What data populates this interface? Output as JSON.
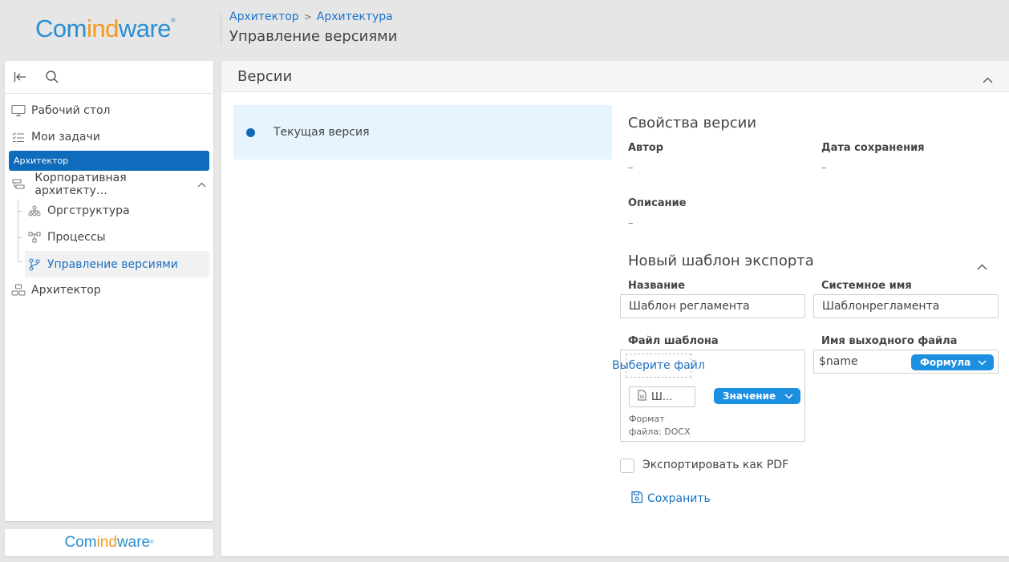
{
  "logo": {
    "part1": "Com",
    "part2": "ind",
    "part3": "ware",
    "mark": "®"
  },
  "breadcrumb": {
    "items": [
      "Архитектор",
      "Архитектура"
    ],
    "separator": ">"
  },
  "page_title": "Управление версиями",
  "sidebar": {
    "group_label": "Архитектор",
    "items": [
      {
        "label": "Рабочий стол",
        "icon": "desktop-icon"
      },
      {
        "label": "Мои задачи",
        "icon": "tasks-icon"
      },
      {
        "label": "Корпоративная архитекту…",
        "icon": "architecture-icon"
      },
      {
        "label": "Оргструктура",
        "icon": "org-structure-icon"
      },
      {
        "label": "Процессы",
        "icon": "process-icon"
      },
      {
        "label": "Управление версиями",
        "icon": "version-branch-icon"
      },
      {
        "label": "Архитектор",
        "icon": "architect-icon"
      }
    ]
  },
  "footer_logo": {
    "part1": "Com",
    "part2": "ind",
    "part3": "ware",
    "mark": "®"
  },
  "versions": {
    "title": "Версии",
    "list": [
      {
        "label": "Текущая версия"
      }
    ]
  },
  "properties": {
    "title": "Свойства версии",
    "author_label": "Автор",
    "author_value": "–",
    "saved_label": "Дата сохранения",
    "saved_value": "–",
    "description_label": "Описание",
    "description_value": "–"
  },
  "export_template": {
    "title": "Новый шаблон экспорта",
    "name_label": "Название",
    "name_value": "Шаблон регламента",
    "system_name_label": "Системное имя",
    "system_name_value": "Шаблонрегламента",
    "file_label": "Файл шаблона",
    "choose_file": "Выберите файл",
    "file_chip": "Ш...",
    "value_pill": "Значение",
    "format_line1": "Формат",
    "format_line2": "файла: DOCX",
    "output_label": "Имя выходного файла",
    "output_value": "$name",
    "formula_pill": "Формула",
    "pdf_label": "Экспортировать как PDF",
    "pdf_checked": false,
    "save_label": "Сохранить"
  },
  "colors": {
    "accent": "#1a6fc2",
    "group_bg": "#0f6cbd",
    "pill": "#1d8fe0",
    "selection_bg": "#e6f4fd",
    "logo_blue": "#2a8fd4",
    "logo_orange": "#f39a1e"
  }
}
